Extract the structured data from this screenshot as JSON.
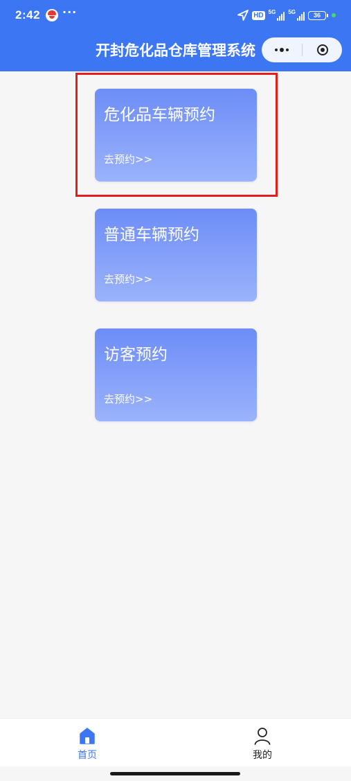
{
  "status_bar": {
    "time": "2:42",
    "dots": "···",
    "hd_badge": "HD",
    "signal_1": "5G",
    "signal_2": "5G",
    "battery": "36"
  },
  "header": {
    "title": "开封危化品仓库管理系统",
    "bg_color": "#3d76f3"
  },
  "cards": [
    {
      "title": "危化品车辆预约",
      "link": "去预约>>",
      "highlighted": true
    },
    {
      "title": "普通车辆预约",
      "link": "去预约>>",
      "highlighted": false
    },
    {
      "title": "访客预约",
      "link": "去预约>>",
      "highlighted": false
    }
  ],
  "tabbar": {
    "items": [
      {
        "label": "首页",
        "icon": "home-icon",
        "active": true
      },
      {
        "label": "我的",
        "icon": "user-icon",
        "active": false
      }
    ],
    "active_color": "#3d76f3"
  },
  "highlight_color": "#e11d1d"
}
